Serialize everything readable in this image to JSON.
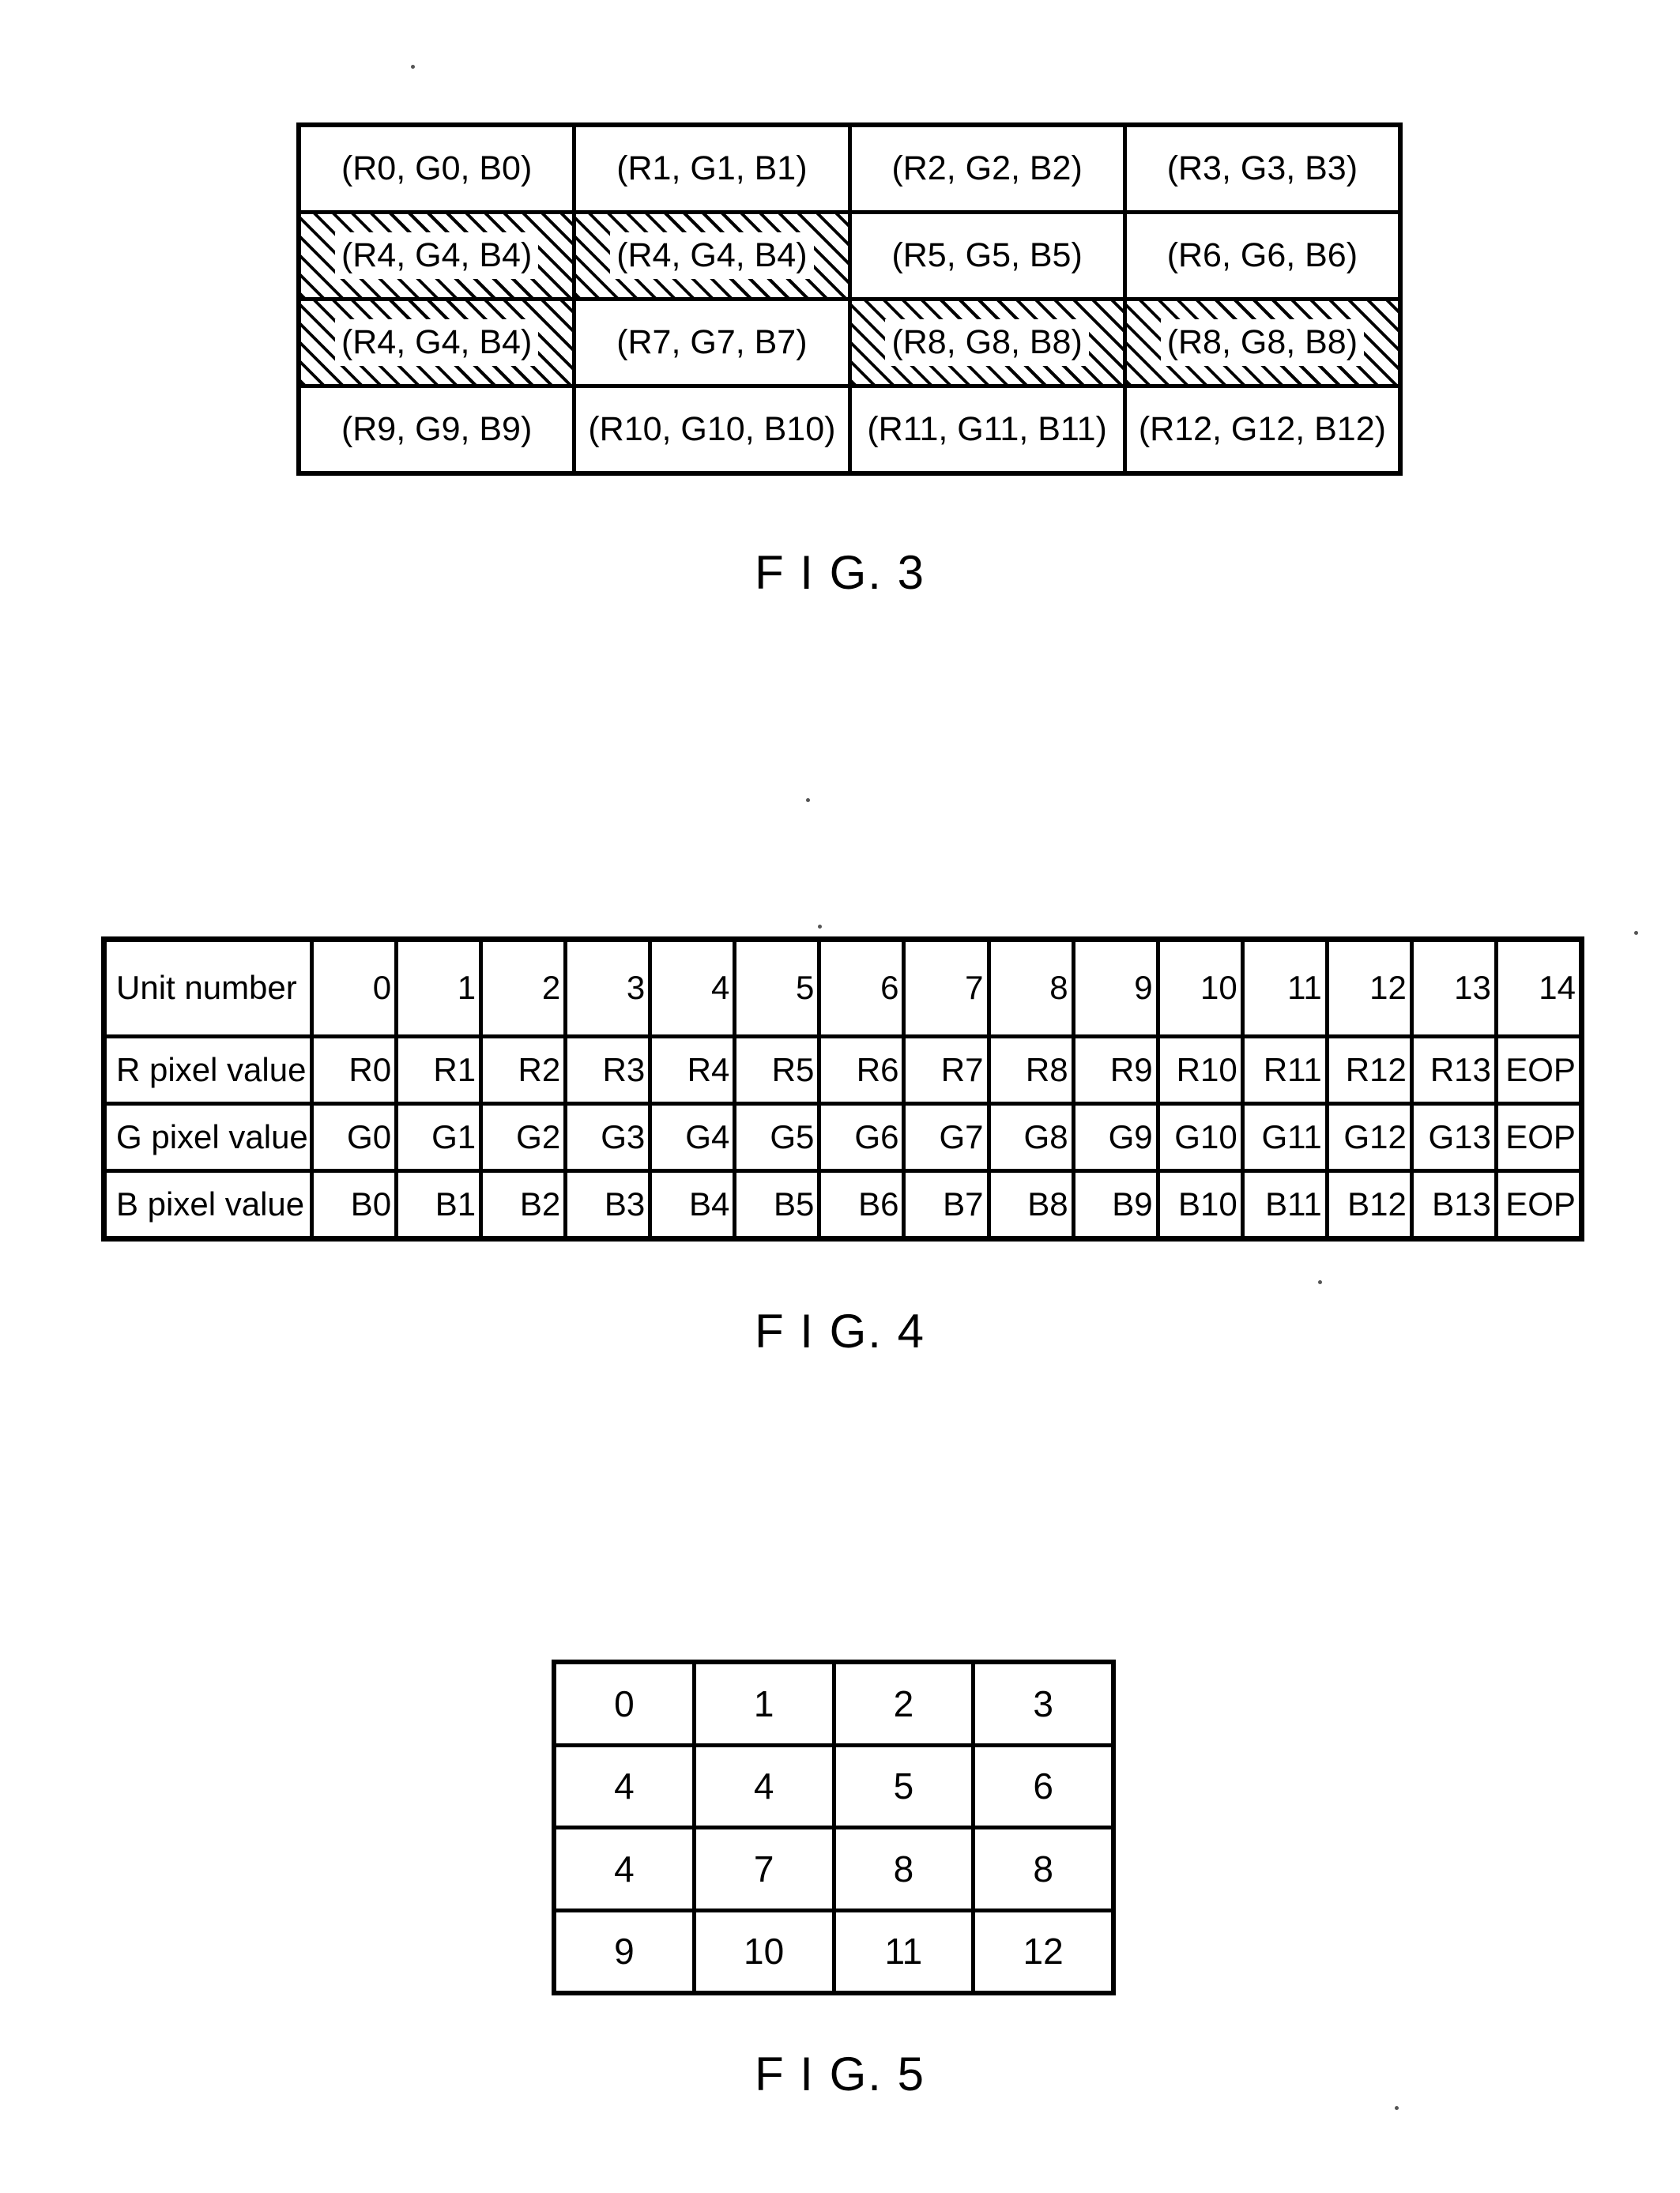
{
  "figures": [
    {
      "id": "fig3",
      "caption": "F I G. 3",
      "caption_prefix": "F I G.",
      "caption_number": "3",
      "type": "pixel-block-grid",
      "rows": [
        [
          {
            "text": "(R0, G0, B0)",
            "hatched": false
          },
          {
            "text": "(R1, G1, B1)",
            "hatched": false
          },
          {
            "text": "(R2, G2, B2)",
            "hatched": false
          },
          {
            "text": "(R3, G3, B3)",
            "hatched": false
          }
        ],
        [
          {
            "text": "(R4, G4, B4)",
            "hatched": true
          },
          {
            "text": "(R4, G4, B4)",
            "hatched": true
          },
          {
            "text": "(R5, G5, B5)",
            "hatched": false
          },
          {
            "text": "(R6, G6, B6)",
            "hatched": false
          }
        ],
        [
          {
            "text": "(R4, G4, B4)",
            "hatched": true
          },
          {
            "text": "(R7, G7, B7)",
            "hatched": false
          },
          {
            "text": "(R8, G8, B8)",
            "hatched": true
          },
          {
            "text": "(R8, G8, B8)",
            "hatched": true
          }
        ],
        [
          {
            "text": "(R9, G9, B9)",
            "hatched": false
          },
          {
            "text": "(R10, G10, B10)",
            "hatched": false
          },
          {
            "text": "(R11, G11, B11)",
            "hatched": false
          },
          {
            "text": "(R12, G12, B12)",
            "hatched": false
          }
        ]
      ]
    },
    {
      "id": "fig4",
      "caption": "F I G. 4",
      "caption_prefix": "F I G.",
      "caption_number": "4",
      "type": "unit-value-table",
      "row_labels": [
        "Unit  number",
        "R  pixel  value",
        "G  pixel  value",
        "B  pixel  value"
      ],
      "unit_numbers": [
        "0",
        "1",
        "2",
        "3",
        "4",
        "5",
        "6",
        "7",
        "8",
        "9",
        "10",
        "11",
        "12",
        "13",
        "14"
      ],
      "r_values": [
        "R0",
        "R1",
        "R2",
        "R3",
        "R4",
        "R5",
        "R6",
        "R7",
        "R8",
        "R9",
        "R10",
        "R11",
        "R12",
        "R13",
        "EOP"
      ],
      "g_values": [
        "G0",
        "G1",
        "G2",
        "G3",
        "G4",
        "G5",
        "G6",
        "G7",
        "G8",
        "G9",
        "G10",
        "G11",
        "G12",
        "G13",
        "EOP"
      ],
      "b_values": [
        "B0",
        "B1",
        "B2",
        "B3",
        "B4",
        "B5",
        "B6",
        "B7",
        "B8",
        "B9",
        "B10",
        "B11",
        "B12",
        "B13",
        "EOP"
      ]
    },
    {
      "id": "fig5",
      "caption": "F I G. 5",
      "caption_prefix": "F I G.",
      "caption_number": "5",
      "type": "index-grid",
      "rows": [
        [
          "0",
          "1",
          "2",
          "3"
        ],
        [
          "4",
          "4",
          "5",
          "6"
        ],
        [
          "4",
          "7",
          "8",
          "8"
        ],
        [
          "9",
          "10",
          "11",
          "12"
        ]
      ]
    }
  ]
}
